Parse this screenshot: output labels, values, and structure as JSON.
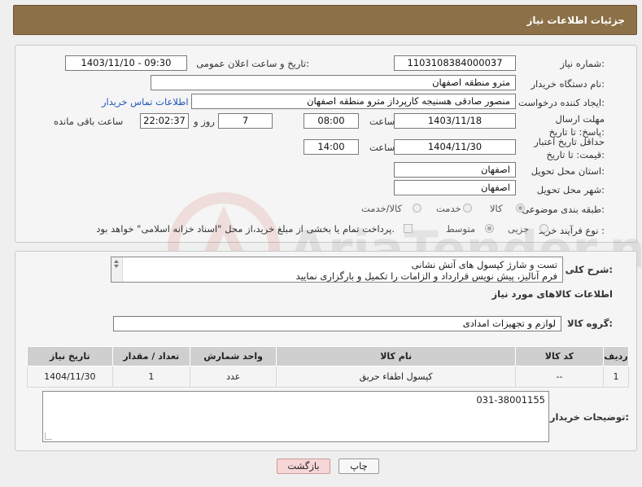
{
  "header": {
    "title": "جزئیات اطلاعات نیاز"
  },
  "form": {
    "need_number_label": "شماره نیاز:",
    "need_number": "1103108384000037",
    "announce_label": "تاریخ و ساعت اعلان عمومی:",
    "announce_value": "1403/11/10 - 09:30",
    "buyer_org_label": "نام دستگاه خریدار:",
    "buyer_org": "مترو منطقه اصفهان",
    "creator_label": "ایجاد کننده درخواست:",
    "creator": "منصور صادقی هسنیجه کارپرداز مترو منطقه اصفهان",
    "contact_link": "اطلاعات تماس خریدار",
    "reply_deadline_label": "مهلت ارسال پاسخ: تا تاریخ:",
    "reply_date": "1403/11/18",
    "time_label": "ساعت",
    "reply_time": "08:00",
    "days_value": "7",
    "days_label": "روز و",
    "remaining_time": "22:02:37",
    "remaining_label": "ساعت باقی مانده",
    "price_validity_label": "حداقل تاریخ اعتبار قیمت: تا تاریخ:",
    "validity_date": "1404/11/30",
    "validity_time_label": "ساعت",
    "validity_time": "14:00",
    "province_label": "استان محل تحویل:",
    "province": "اصفهان",
    "city_label": "شهر محل تحویل:",
    "city": "اصفهان",
    "category_label": "طبقه بندی موضوعی:",
    "category_options": [
      "کالا",
      "خدمت",
      "کالا/خدمت"
    ],
    "process_label": "نوع فرآیند خرید :",
    "process_options": [
      "جزیی",
      "متوسط"
    ],
    "payment_note": "پرداخت تمام یا بخشی از مبلغ خرید،از محل \"اسناد خزانه اسلامی\" خواهد بود."
  },
  "description": {
    "label": "شرح کلی نیاز:",
    "line1": "تست و شارژ کپسول های آتش نشانی",
    "line2": "فرم آنالیز، پیش نویس قرارداد و الزامات را تکمیل و بارگزاری نمایید"
  },
  "goods": {
    "section_title": "اطلاعات کالاهای مورد نیاز",
    "group_label": "گروه کالا:",
    "group_value": "لوازم و تجهیزات امدادی",
    "columns": [
      "ردیف",
      "کد کالا",
      "نام کالا",
      "واحد شمارش",
      "تعداد / مقدار",
      "تاریخ نیاز"
    ],
    "rows": [
      {
        "row": "1",
        "code": "--",
        "name": "کپسول اطفاء حریق",
        "unit": "عدد",
        "qty": "1",
        "date": "1404/11/30"
      }
    ]
  },
  "buyer_notes": {
    "label": "توضیحات خریدار:",
    "value": "031-38001155"
  },
  "buttons": {
    "print": "چاپ",
    "back": "بازگشت"
  },
  "watermark": {
    "text": "AriaTender.neT"
  },
  "colors": {
    "header_bg": "#8c7048",
    "link": "#2255bb",
    "back_button_bg": "#f6d6d6"
  }
}
